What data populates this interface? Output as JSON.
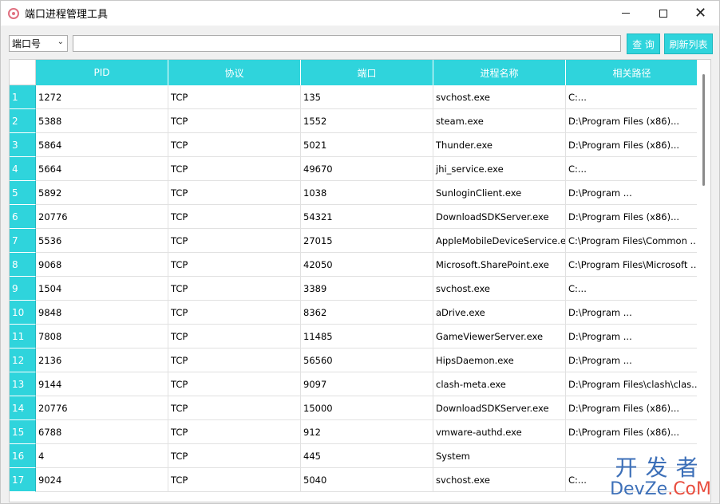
{
  "window": {
    "title": "端口进程管理工具",
    "controls": {
      "minimize": "—",
      "maximize": "☐",
      "close": "✕"
    }
  },
  "toolbar": {
    "filter_select": {
      "selected": "端口号"
    },
    "search": {
      "value": "",
      "placeholder": ""
    },
    "query_label": "查 询",
    "refresh_label": "刷新列表"
  },
  "colors": {
    "accent": "#2fd4dc",
    "accent_border": "#21b7be",
    "watermark": "#3c6fb8",
    "watermark_accent": "#e84c3d"
  },
  "table": {
    "columns": [
      "PID",
      "协议",
      "端口",
      "进程名称",
      "相关路径"
    ],
    "rows": [
      {
        "num": "1",
        "pid": "1272",
        "protocol": "TCP",
        "port": "135",
        "name": "svchost.exe",
        "path": "C:..."
      },
      {
        "num": "2",
        "pid": "5388",
        "protocol": "TCP",
        "port": "1552",
        "name": "steam.exe",
        "path": "D:\\Program Files (x86)..."
      },
      {
        "num": "3",
        "pid": "5864",
        "protocol": "TCP",
        "port": "5021",
        "name": "Thunder.exe",
        "path": "D:\\Program Files (x86)..."
      },
      {
        "num": "4",
        "pid": "5664",
        "protocol": "TCP",
        "port": "49670",
        "name": "jhi_service.exe",
        "path": "C:..."
      },
      {
        "num": "5",
        "pid": "5892",
        "protocol": "TCP",
        "port": "1038",
        "name": "SunloginClient.exe",
        "path": "D:\\Program ..."
      },
      {
        "num": "6",
        "pid": "20776",
        "protocol": "TCP",
        "port": "54321",
        "name": "DownloadSDKServer.exe",
        "path": "D:\\Program Files (x86)..."
      },
      {
        "num": "7",
        "pid": "5536",
        "protocol": "TCP",
        "port": "27015",
        "name": "AppleMobileDeviceService.e...",
        "path": "C:\\Program Files\\Common ..."
      },
      {
        "num": "8",
        "pid": "9068",
        "protocol": "TCP",
        "port": "42050",
        "name": "Microsoft.SharePoint.exe",
        "path": "C:\\Program Files\\Microsoft ..."
      },
      {
        "num": "9",
        "pid": "1504",
        "protocol": "TCP",
        "port": "3389",
        "name": "svchost.exe",
        "path": "C:..."
      },
      {
        "num": "10",
        "pid": "9848",
        "protocol": "TCP",
        "port": "8362",
        "name": "aDrive.exe",
        "path": "D:\\Program ..."
      },
      {
        "num": "11",
        "pid": "7808",
        "protocol": "TCP",
        "port": "11485",
        "name": "GameViewerServer.exe",
        "path": "D:\\Program ..."
      },
      {
        "num": "12",
        "pid": "2136",
        "protocol": "TCP",
        "port": "56560",
        "name": "HipsDaemon.exe",
        "path": "D:\\Program ..."
      },
      {
        "num": "13",
        "pid": "9144",
        "protocol": "TCP",
        "port": "9097",
        "name": "clash-meta.exe",
        "path": "D:\\Program Files\\clash\\clas..."
      },
      {
        "num": "14",
        "pid": "20776",
        "protocol": "TCP",
        "port": "15000",
        "name": "DownloadSDKServer.exe",
        "path": "D:\\Program Files (x86)..."
      },
      {
        "num": "15",
        "pid": "6788",
        "protocol": "TCP",
        "port": "912",
        "name": "vmware-authd.exe",
        "path": "D:\\Program Files (x86)..."
      },
      {
        "num": "16",
        "pid": "4",
        "protocol": "TCP",
        "port": "445",
        "name": "System",
        "path": ""
      },
      {
        "num": "17",
        "pid": "9024",
        "protocol": "TCP",
        "port": "5040",
        "name": "svchost.exe",
        "path": "C:..."
      }
    ]
  },
  "watermark": {
    "line1": "开发者",
    "line2_a": "DevZe",
    "line2_b": ".CoM"
  }
}
